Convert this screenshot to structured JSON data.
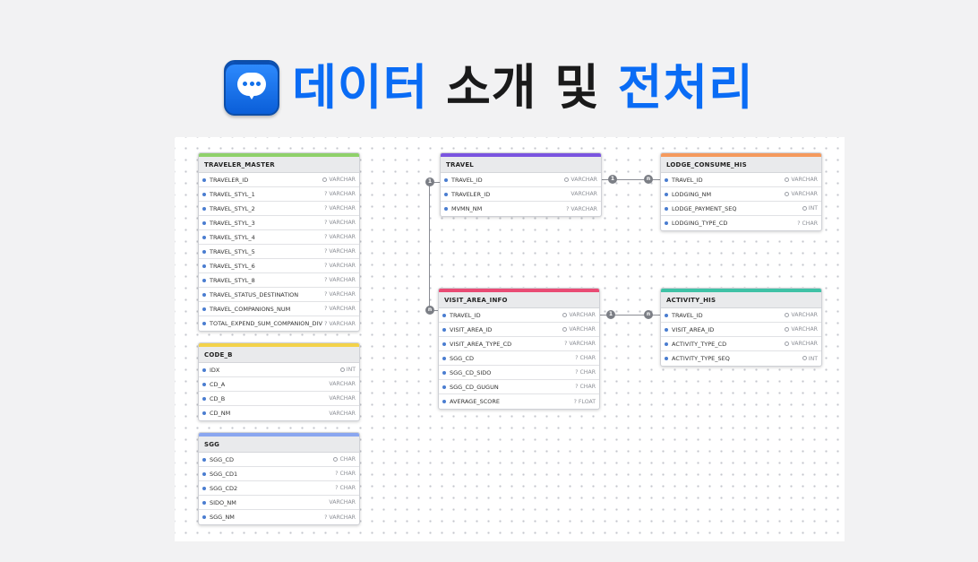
{
  "title": {
    "part1": "데이터",
    "part2": "소개 및",
    "part3": "전처리"
  },
  "icon": "chat-bubble-icon",
  "colors": {
    "title_blue": "#0a6cf5",
    "traveler_master": "#8fd16a",
    "code_b": "#f3d24a",
    "sgg": "#8aa6f0",
    "travel": "#7b55e0",
    "visit_area_info": "#e94b74",
    "lodge_consume_his": "#f59a5d",
    "activity_his": "#3fc2a6"
  },
  "relations": [
    {
      "from_label": "1",
      "to_label": "n"
    },
    {
      "from_label": "1",
      "to_label": "n"
    },
    {
      "from_label": "1",
      "to_label": "n"
    }
  ],
  "tables": {
    "traveler_master": {
      "name": "TRAVELER_MASTER",
      "columns": [
        {
          "name": "TRAVELER_ID",
          "type": "VARCHAR",
          "key": "pk"
        },
        {
          "name": "TRAVEL_STYL_1",
          "type": "VARCHAR",
          "key": "null"
        },
        {
          "name": "TRAVEL_STYL_2",
          "type": "VARCHAR",
          "key": "null"
        },
        {
          "name": "TRAVEL_STYL_3",
          "type": "VARCHAR",
          "key": "null"
        },
        {
          "name": "TRAVEL_STYL_4",
          "type": "VARCHAR",
          "key": "null"
        },
        {
          "name": "TRAVEL_STYL_5",
          "type": "VARCHAR",
          "key": "null"
        },
        {
          "name": "TRAVEL_STYL_6",
          "type": "VARCHAR",
          "key": "null"
        },
        {
          "name": "TRAVEL_STYL_8",
          "type": "VARCHAR",
          "key": "null"
        },
        {
          "name": "TRAVEL_STATUS_DESTINATION",
          "type": "VARCHAR",
          "key": "null"
        },
        {
          "name": "TRAVEL_COMPANIONS_NUM",
          "type": "VARCHAR",
          "key": "null"
        },
        {
          "name": "TOTAL_EXPEND_SUM_COMPANION_DIV",
          "type": "VARCHAR",
          "key": "null"
        }
      ]
    },
    "code_b": {
      "name": "CODE_B",
      "columns": [
        {
          "name": "IDX",
          "type": "INT",
          "key": "pk"
        },
        {
          "name": "CD_A",
          "type": "VARCHAR",
          "key": ""
        },
        {
          "name": "CD_B",
          "type": "VARCHAR",
          "key": ""
        },
        {
          "name": "CD_NM",
          "type": "VARCHAR",
          "key": ""
        }
      ]
    },
    "sgg": {
      "name": "SGG",
      "columns": [
        {
          "name": "SGG_CD",
          "type": "CHAR",
          "key": "pk"
        },
        {
          "name": "SGG_CD1",
          "type": "CHAR",
          "key": "null"
        },
        {
          "name": "SGG_CD2",
          "type": "CHAR",
          "key": "null"
        },
        {
          "name": "SIDO_NM",
          "type": "VARCHAR",
          "key": ""
        },
        {
          "name": "SGG_NM",
          "type": "VARCHAR",
          "key": "null"
        }
      ]
    },
    "travel": {
      "name": "TRAVEL",
      "columns": [
        {
          "name": "TRAVEL_ID",
          "type": "VARCHAR",
          "key": "pk"
        },
        {
          "name": "TRAVELER_ID",
          "type": "VARCHAR",
          "key": ""
        },
        {
          "name": "MVMN_NM",
          "type": "VARCHAR",
          "key": "null"
        }
      ]
    },
    "visit_area_info": {
      "name": "VISIT_AREA_INFO",
      "columns": [
        {
          "name": "TRAVEL_ID",
          "type": "VARCHAR",
          "key": "pk"
        },
        {
          "name": "VISIT_AREA_ID",
          "type": "VARCHAR",
          "key": "pk"
        },
        {
          "name": "VISIT_AREA_TYPE_CD",
          "type": "VARCHAR",
          "key": "null"
        },
        {
          "name": "SGG_CD",
          "type": "CHAR",
          "key": "null"
        },
        {
          "name": "SGG_CD_SIDO",
          "type": "CHAR",
          "key": "null"
        },
        {
          "name": "SGG_CD_GUGUN",
          "type": "CHAR",
          "key": "null"
        },
        {
          "name": "AVERAGE_SCORE",
          "type": "FLOAT",
          "key": "null"
        }
      ]
    },
    "lodge_consume_his": {
      "name": "LODGE_CONSUME_HIS",
      "columns": [
        {
          "name": "TRAVEL_ID",
          "type": "VARCHAR",
          "key": "pk"
        },
        {
          "name": "LODGING_NM",
          "type": "VARCHAR",
          "key": "pk"
        },
        {
          "name": "LODGE_PAYMENT_SEQ",
          "type": "INT",
          "key": "pk"
        },
        {
          "name": "LODGING_TYPE_CD",
          "type": "CHAR",
          "key": "null"
        }
      ]
    },
    "activity_his": {
      "name": "ACTIVITY_HIS",
      "columns": [
        {
          "name": "TRAVEL_ID",
          "type": "VARCHAR",
          "key": "pk"
        },
        {
          "name": "VISIT_AREA_ID",
          "type": "VARCHAR",
          "key": "pk"
        },
        {
          "name": "ACTIVITY_TYPE_CD",
          "type": "VARCHAR",
          "key": "pk"
        },
        {
          "name": "ACTIVITY_TYPE_SEQ",
          "type": "INT",
          "key": "pk"
        }
      ]
    }
  }
}
